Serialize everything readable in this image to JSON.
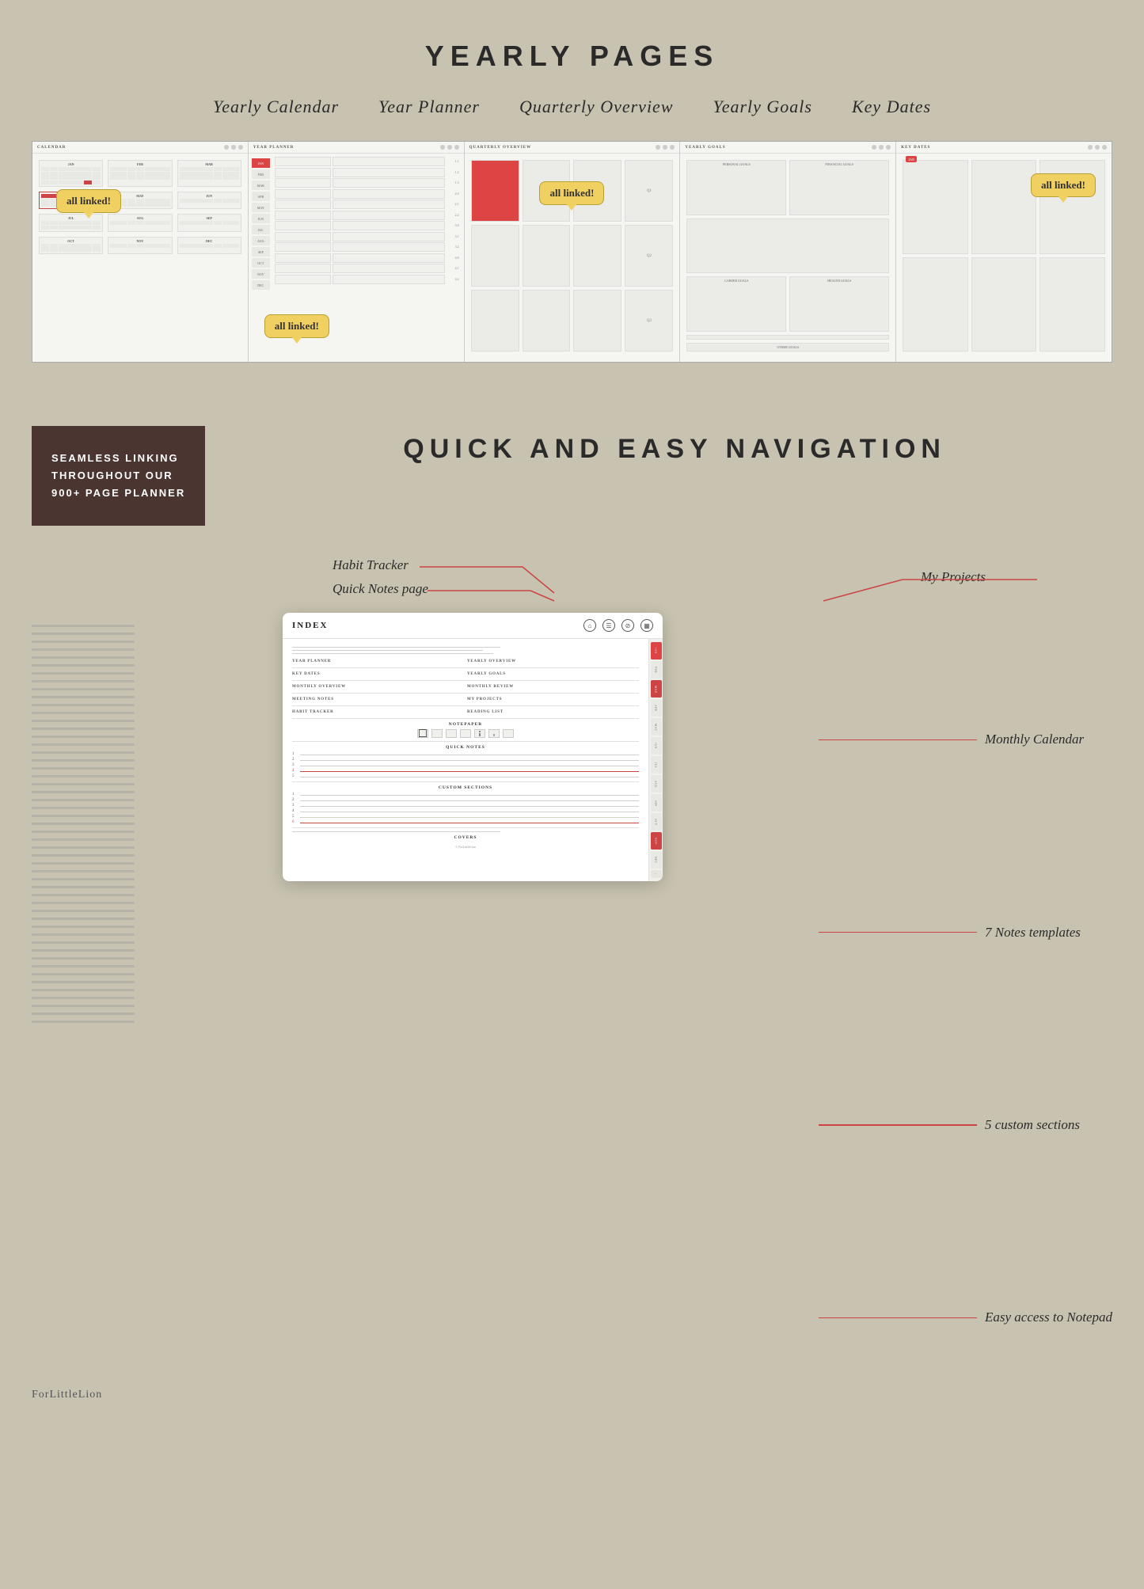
{
  "page": {
    "bg_color": "#c8c3b0"
  },
  "yearly_section": {
    "title": "YEARLY PAGES",
    "subtitle_items": [
      "Yearly Calendar",
      "Year Planner",
      "Quarterly Overview",
      "Yearly Goals",
      "Key Dates"
    ],
    "panels": [
      {
        "id": "yearly-calendar",
        "header": "CALENDAR",
        "tooltip": "all linked!",
        "tooltip_position": "top-left"
      },
      {
        "id": "year-planner",
        "header": "YEAR PLANNER",
        "tooltip": "all linked!",
        "tooltip_position": "bottom-left"
      },
      {
        "id": "quarterly-overview",
        "header": "QUARTERLY OVERVIEW",
        "tooltip": "all linked!",
        "tooltip_position": "top-center"
      },
      {
        "id": "yearly-goals",
        "header": "YEARLY GOALS",
        "tooltip": null
      },
      {
        "id": "key-dates",
        "header": "KEY DATES",
        "tooltip": "all linked!",
        "tooltip_position": "top-right"
      }
    ]
  },
  "nav_section": {
    "linking_box": {
      "line1": "SEAMLESS LINKING",
      "line2": "THROUGHOUT OUR",
      "line3": "900+ PAGE",
      "line4": "PLANNER"
    },
    "main_title": "QUICK AND EASY NAVIGATION"
  },
  "index_section": {
    "annotations": {
      "habit_tracker": "Habit Tracker",
      "quick_notes": "Quick Notes page",
      "my_projects": "My Projects",
      "monthly_calendar": "Monthly Calendar",
      "notes_templates": "7 Notes templates",
      "custom_sections": "5 custom sections",
      "easy_access": "Easy access to Notepad"
    },
    "device": {
      "title": "INDEX",
      "nav_items_col1": [
        "YEAR PLANNER",
        "KEY DATES",
        "MONTHLY OVERVIEW",
        "MEETING NOTES",
        "HABIT TRACKER"
      ],
      "nav_items_col2": [
        "YEARLY OVERVIEW",
        "YEARLY GOALS",
        "MONTHLY REVIEW",
        "MY PROJECTS",
        "READING LIST"
      ],
      "section_notepaper": "NOTEPAPER",
      "section_quick_notes": "QUICK NOTES",
      "section_custom_sections": "CUSTOM SECTIONS",
      "section_covers": "COVERS",
      "sidebar_tabs": [
        "JAN",
        "FEB",
        "MAR",
        "APR",
        "MAY",
        "JUN",
        "JUL",
        "AUG",
        "SEP",
        "OCT",
        "NOV",
        "DEC"
      ],
      "quick_note_numbers": [
        "1",
        "2",
        "3",
        "4",
        "5"
      ],
      "custom_section_numbers": [
        "1",
        "2",
        "3",
        "4",
        "5",
        "6"
      ]
    }
  },
  "footer": {
    "brand": "ForLittleLion",
    "copyright": "© ForLittleLion"
  }
}
